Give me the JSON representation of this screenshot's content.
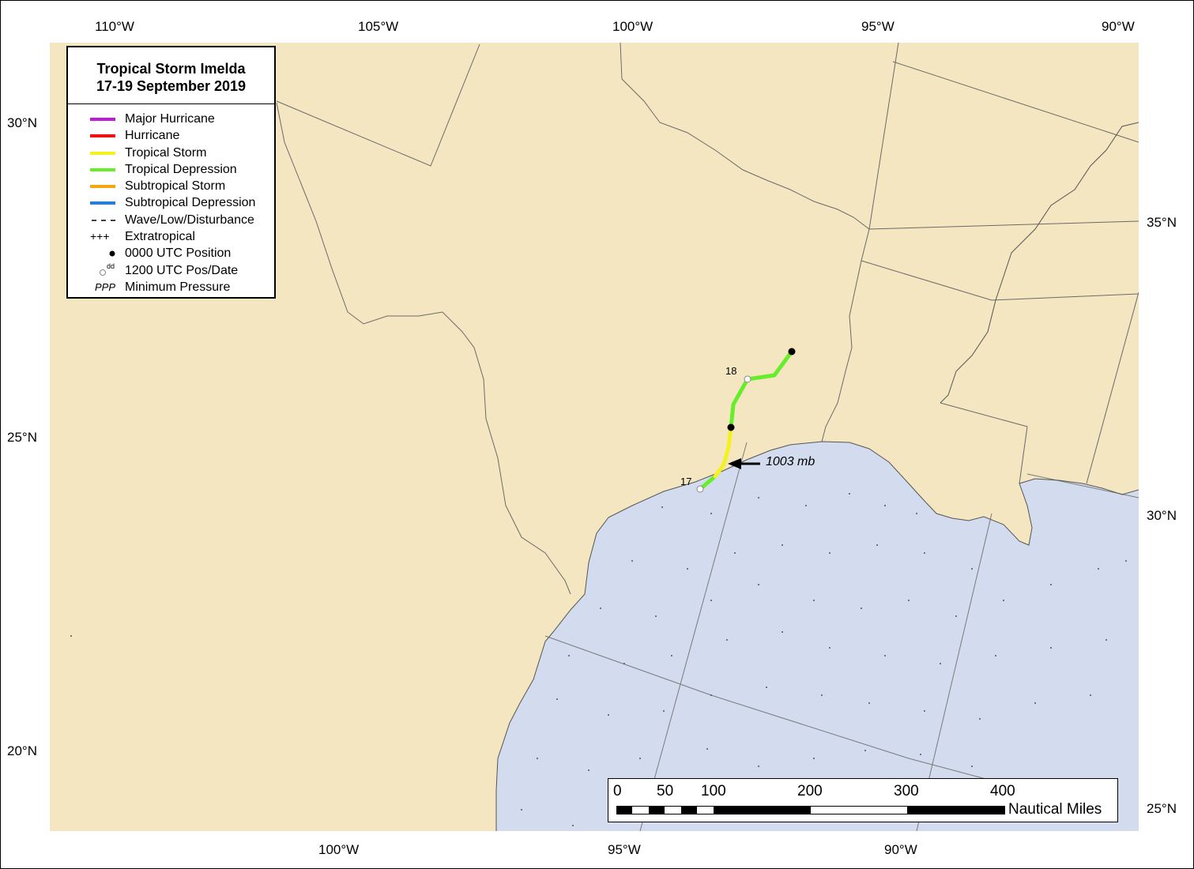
{
  "map": {
    "title_line1": "Tropical Storm Imelda",
    "title_line2": "17-19 September 2019",
    "top_longitudes": [
      "110°W",
      "105°W",
      "100°W",
      "95°W",
      "90°W"
    ],
    "bottom_longitudes": [
      "100°W",
      "95°W",
      "90°W"
    ],
    "left_latitudes": [
      "30°N",
      "25°N",
      "20°N"
    ],
    "right_latitudes": [
      "35°N",
      "30°N",
      "25°N"
    ],
    "colors": {
      "land": "#f3e6c0",
      "water": "#d2dcee",
      "major_hurricane": "#c21ad9",
      "hurricane": "#ee1111",
      "tropical_storm": "#f4f21e",
      "tropical_depression": "#66ee2a",
      "subtropical_storm": "#f6a410",
      "subtropical_depression": "#1e7fe6"
    }
  },
  "legend": {
    "major_hurricane": "Major Hurricane",
    "hurricane": "Hurricane",
    "tropical_storm": "Tropical Storm",
    "tropical_depression": "Tropical Depression",
    "subtropical_storm": "Subtropical Storm",
    "subtropical_depression": "Subtropical Depression",
    "wave": "Wave/Low/Disturbance",
    "extratropical": "Extratropical",
    "extratropical_symbol": "+++",
    "utc0000": "0000 UTC Position",
    "utc1200": "1200 UTC Pos/Date",
    "utc1200_symbol": "dd",
    "minpressure": "Minimum Pressure",
    "minpressure_symbol": "PPP"
  },
  "track": {
    "date_labels": [
      "17",
      "18"
    ],
    "min_pressure_label": "1003 mb"
  },
  "scale": {
    "ticks": [
      "0",
      "50",
      "100",
      "200",
      "300",
      "400"
    ],
    "unit": "Nautical Miles"
  }
}
